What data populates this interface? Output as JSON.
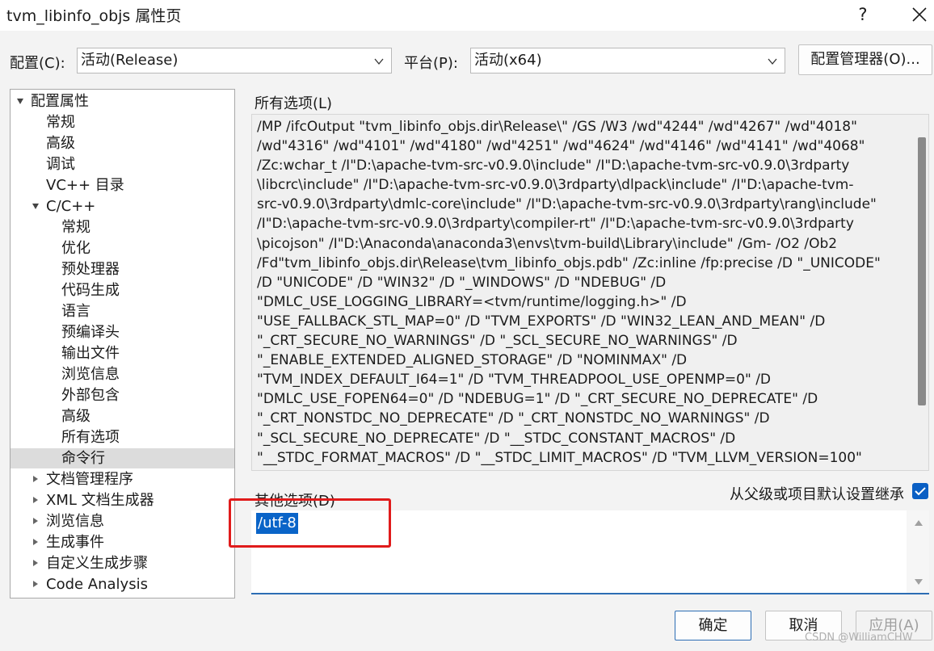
{
  "window": {
    "title": "tvm_libinfo_objs 属性页",
    "help_label": "?",
    "close_icon": "close-icon"
  },
  "config_row": {
    "config_label": "配置(C):",
    "config_value": "活动(Release)",
    "platform_label": "平台(P):",
    "platform_value": "活动(x64)",
    "manager_button": "配置管理器(O)..."
  },
  "tree": {
    "items": [
      {
        "label": "配置属性"
      },
      {
        "label": "常规"
      },
      {
        "label": "高级"
      },
      {
        "label": "调试"
      },
      {
        "label": "VC++ 目录"
      },
      {
        "label": "C/C++"
      },
      {
        "label": "常规"
      },
      {
        "label": "优化"
      },
      {
        "label": "预处理器"
      },
      {
        "label": "代码生成"
      },
      {
        "label": "语言"
      },
      {
        "label": "预编译头"
      },
      {
        "label": "输出文件"
      },
      {
        "label": "浏览信息"
      },
      {
        "label": "外部包含"
      },
      {
        "label": "高级"
      },
      {
        "label": "所有选项"
      },
      {
        "label": "命令行"
      },
      {
        "label": "文档管理程序"
      },
      {
        "label": "XML 文档生成器"
      },
      {
        "label": "浏览信息"
      },
      {
        "label": "生成事件"
      },
      {
        "label": "自定义生成步骤"
      },
      {
        "label": "Code Analysis"
      }
    ],
    "selected": "命令行"
  },
  "all_options": {
    "label": "所有选项(L)",
    "text": "/MP /ifcOutput \"tvm_libinfo_objs.dir\\Release\\\" /GS /W3 /wd\"4244\" /wd\"4267\" /wd\"4018\"\n/wd\"4316\" /wd\"4101\" /wd\"4180\" /wd\"4251\" /wd\"4624\" /wd\"4146\" /wd\"4141\" /wd\"4068\"\n/Zc:wchar_t /I\"D:\\apache-tvm-src-v0.9.0\\include\" /I\"D:\\apache-tvm-src-v0.9.0\\3rdparty\n\\libcrc\\include\" /I\"D:\\apache-tvm-src-v0.9.0\\3rdparty\\dlpack\\include\" /I\"D:\\apache-tvm-\nsrc-v0.9.0\\3rdparty\\dmlc-core\\include\" /I\"D:\\apache-tvm-src-v0.9.0\\3rdparty\\rang\\include\"\n/I\"D:\\apache-tvm-src-v0.9.0\\3rdparty\\compiler-rt\" /I\"D:\\apache-tvm-src-v0.9.0\\3rdparty\n\\picojson\" /I\"D:\\Anaconda\\anaconda3\\envs\\tvm-build\\Library\\include\" /Gm- /O2 /Ob2\n/Fd\"tvm_libinfo_objs.dir\\Release\\tvm_libinfo_objs.pdb\" /Zc:inline /fp:precise /D \"_UNICODE\"\n/D \"UNICODE\" /D \"WIN32\" /D \"_WINDOWS\" /D \"NDEBUG\" /D\n\"DMLC_USE_LOGGING_LIBRARY=<tvm/runtime/logging.h>\" /D\n\"USE_FALLBACK_STL_MAP=0\" /D \"TVM_EXPORTS\" /D \"WIN32_LEAN_AND_MEAN\" /D\n\"_CRT_SECURE_NO_WARNINGS\" /D \"_SCL_SECURE_NO_WARNINGS\" /D\n\"_ENABLE_EXTENDED_ALIGNED_STORAGE\" /D \"NOMINMAX\" /D\n\"TVM_INDEX_DEFAULT_I64=1\" /D \"TVM_THREADPOOL_USE_OPENMP=0\" /D\n\"DMLC_USE_FOPEN64=0\" /D \"NDEBUG=1\" /D \"_CRT_SECURE_NO_DEPRECATE\" /D\n\"_CRT_NONSTDC_NO_DEPRECATE\" /D \"_CRT_NONSTDC_NO_WARNINGS\" /D\n\"_SCL_SECURE_NO_DEPRECATE\" /D \"__STDC_CONSTANT_MACROS\" /D\n\"__STDC_FORMAT_MACROS\" /D \"__STDC_LIMIT_MACROS\" /D \"TVM_LLVM_VERSION=100\""
  },
  "other_options": {
    "label": "其他选项(D)",
    "value": "/utf-8",
    "inherit_label": "从父级或项目默认设置继承",
    "inherit_checked": true
  },
  "buttons": {
    "ok": "确定",
    "cancel": "取消",
    "apply": "应用(A)"
  },
  "watermark": "CSDN @WilliamCHW",
  "colors": {
    "accent": "#0a64c8",
    "highlight_box": "#e01b1b",
    "selected_tree": "#dcdcdc"
  }
}
